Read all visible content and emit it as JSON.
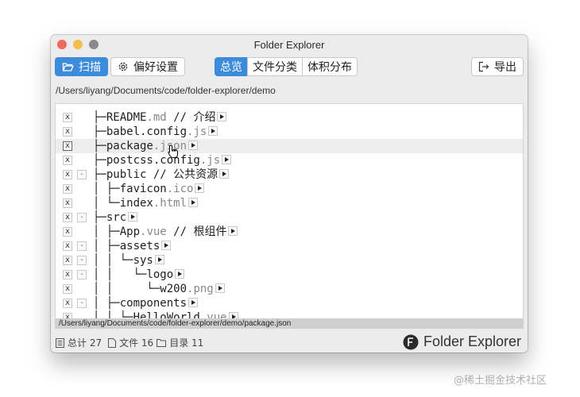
{
  "window": {
    "title": "Folder Explorer"
  },
  "toolbar": {
    "scan_label": "扫描",
    "settings_label": "偏好设置",
    "tabs": [
      {
        "label": "总览",
        "active": true
      },
      {
        "label": "文件分类",
        "active": false
      },
      {
        "label": "体积分布",
        "active": false
      }
    ],
    "export_label": "导出"
  },
  "path": "/Users/liyang/Documents/code/folder-explorer/demo",
  "tree": [
    {
      "prefix": "├─",
      "name": "README",
      "ext": ".md",
      "comment": " // 介绍",
      "collapsible": false
    },
    {
      "prefix": "├─",
      "name": "babel.config",
      "ext": ".js",
      "comment": "",
      "collapsible": false
    },
    {
      "prefix": "├─",
      "name": "package",
      "ext": ".json",
      "comment": "",
      "collapsible": false,
      "highlighted": true
    },
    {
      "prefix": "├─",
      "name": "postcss.config",
      "ext": ".js",
      "comment": "",
      "collapsible": false
    },
    {
      "prefix": "├─",
      "name": "public",
      "ext": "",
      "comment": " // 公共资源",
      "collapsible": true
    },
    {
      "prefix": "│ ├─",
      "name": "favicon",
      "ext": ".ico",
      "comment": "",
      "collapsible": false
    },
    {
      "prefix": "│ └─",
      "name": "index",
      "ext": ".html",
      "comment": "",
      "collapsible": false
    },
    {
      "prefix": "├─",
      "name": "src",
      "ext": "",
      "comment": "",
      "collapsible": true
    },
    {
      "prefix": "│ ├─",
      "name": "App",
      "ext": ".vue",
      "comment": " // 根组件",
      "collapsible": false
    },
    {
      "prefix": "│ ├─",
      "name": "assets",
      "ext": "",
      "comment": "",
      "collapsible": true
    },
    {
      "prefix": "│ │ └─",
      "name": "sys",
      "ext": "",
      "comment": "",
      "collapsible": true
    },
    {
      "prefix": "│ │   └─",
      "name": "logo",
      "ext": "",
      "comment": "",
      "collapsible": true
    },
    {
      "prefix": "│ │     └─",
      "name": "w200",
      "ext": ".png",
      "comment": "",
      "collapsible": false
    },
    {
      "prefix": "│ ├─",
      "name": "components",
      "ext": "",
      "comment": "",
      "collapsible": true
    },
    {
      "prefix": "│ │ └─",
      "name": "HelloWorld",
      "ext": ".vue",
      "comment": "",
      "collapsible": false
    }
  ],
  "selected_path": "/Users/liyang/Documents/code/folder-explorer/demo/package.json",
  "stats": {
    "total": "总计 27",
    "files": "文件 16",
    "dirs": "目录 11"
  },
  "brand": "Folder Explorer",
  "watermark": "@稀土掘金技术社区",
  "colors": {
    "accent": "#3d8bdb",
    "extension": "#888888"
  }
}
